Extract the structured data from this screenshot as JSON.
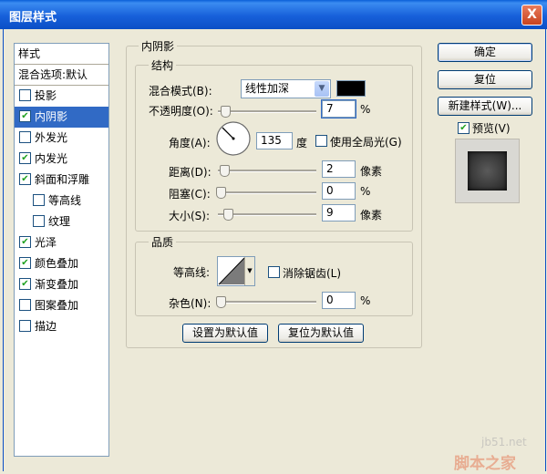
{
  "window": {
    "title": "图层样式",
    "close": "X"
  },
  "stylelist": {
    "header": "样式",
    "blend_options": "混合选项:默认",
    "items": [
      {
        "label": "投影",
        "checked": false,
        "selected": false,
        "indent": false
      },
      {
        "label": "内阴影",
        "checked": true,
        "selected": true,
        "indent": false
      },
      {
        "label": "外发光",
        "checked": false,
        "selected": false,
        "indent": false
      },
      {
        "label": "内发光",
        "checked": true,
        "selected": false,
        "indent": false
      },
      {
        "label": "斜面和浮雕",
        "checked": true,
        "selected": false,
        "indent": false
      },
      {
        "label": "等高线",
        "checked": false,
        "selected": false,
        "indent": true
      },
      {
        "label": "纹理",
        "checked": false,
        "selected": false,
        "indent": true
      },
      {
        "label": "光泽",
        "checked": true,
        "selected": false,
        "indent": false
      },
      {
        "label": "颜色叠加",
        "checked": true,
        "selected": false,
        "indent": false
      },
      {
        "label": "渐变叠加",
        "checked": true,
        "selected": false,
        "indent": false
      },
      {
        "label": "图案叠加",
        "checked": false,
        "selected": false,
        "indent": false
      },
      {
        "label": "描边",
        "checked": false,
        "selected": false,
        "indent": false
      }
    ]
  },
  "inner_shadow": {
    "title": "内阴影",
    "structure": {
      "title": "结构",
      "blend_mode_label": "混合模式(B):",
      "blend_mode_value": "线性加深",
      "blend_color": "#000000",
      "opacity_label": "不透明度(O):",
      "opacity_value": "7",
      "opacity_unit": "%",
      "angle_label": "角度(A):",
      "angle_value": "135",
      "angle_unit": "度",
      "global_light_label": "使用全局光(G)",
      "global_light_checked": false,
      "distance_label": "距离(D):",
      "distance_value": "2",
      "distance_unit": "像素",
      "choke_label": "阻塞(C):",
      "choke_value": "0",
      "choke_unit": "%",
      "size_label": "大小(S):",
      "size_value": "9",
      "size_unit": "像素"
    },
    "quality": {
      "title": "品质",
      "contour_label": "等高线:",
      "anti_alias_label": "消除锯齿(L)",
      "anti_alias_checked": false,
      "noise_label": "杂色(N):",
      "noise_value": "0",
      "noise_unit": "%"
    },
    "set_default": "设置为默认值",
    "reset_default": "复位为默认值"
  },
  "buttons": {
    "ok": "确定",
    "reset": "复位",
    "new_style": "新建样式(W)...",
    "preview_label": "预览(V)",
    "preview_checked": true
  },
  "watermark": {
    "site": "jb51.net",
    "name": "脚本之家"
  }
}
